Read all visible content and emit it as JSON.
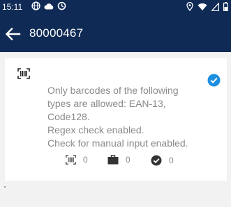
{
  "status_bar": {
    "time": "15:11",
    "icons_left": [
      "globe-icon",
      "cloud-icon",
      "sync-icon"
    ],
    "icons_right": [
      "location-icon",
      "wifi-icon",
      "signal-icon",
      "battery-icon"
    ]
  },
  "app_bar": {
    "title": "80000467",
    "background": "#0e2a55"
  },
  "card": {
    "selected": true,
    "icon": "barcode-scan-icon",
    "check_color": "#1d8fe0",
    "lines": [
      "Only barcodes of the following",
      "types are allowed: EAN-13,",
      "Code128.",
      "Regex check enabled.",
      "Check for manual input enabled."
    ],
    "counters": {
      "scanned": "0",
      "packages": "0",
      "completed": "0"
    }
  }
}
